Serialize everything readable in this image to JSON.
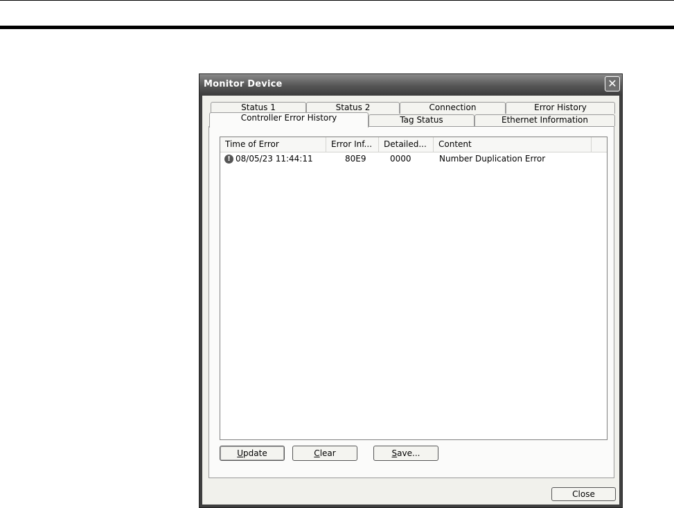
{
  "window": {
    "title": "Monitor Device",
    "close_glyph": "✕"
  },
  "tabs_row1": [
    "Status 1",
    "Status 2",
    "Connection",
    "Error History"
  ],
  "tabs_row2": [
    "Controller Error History",
    "Tag Status",
    "Ethernet Information"
  ],
  "active_tab": "Controller Error History",
  "table": {
    "columns": [
      "Time of Error",
      "Error Inf...",
      "Detailed...",
      "Content"
    ],
    "rows": [
      {
        "icon": "error-icon",
        "time": "08/05/23 11:44:11",
        "error_info": "80E9",
        "detailed": "0000",
        "content": "Number Duplication Error"
      }
    ]
  },
  "buttons": {
    "update": {
      "mnemonic": "U",
      "rest": "pdate"
    },
    "clear": {
      "mnemonic": "C",
      "rest": "lear"
    },
    "save": {
      "mnemonic": "S",
      "rest": "ave..."
    },
    "close": "Close"
  },
  "colors": {
    "titlebar": "#555555",
    "client": "#f1f1ec"
  }
}
